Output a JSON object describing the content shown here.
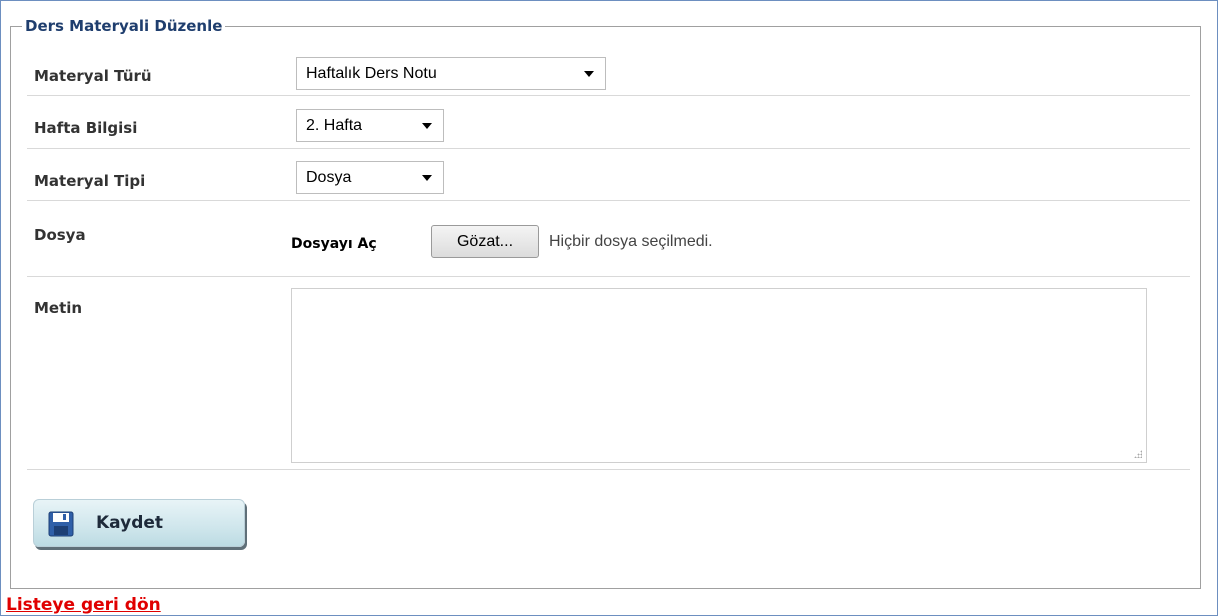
{
  "form": {
    "legend": "Ders Materyali Düzenle",
    "rows": {
      "material_type": {
        "label": "Materyal Türü",
        "value": "Haftalık Ders Notu"
      },
      "week": {
        "label": "Hafta Bilgisi",
        "value": "2. Hafta"
      },
      "material_kind": {
        "label": "Materyal Tipi",
        "value": "Dosya"
      },
      "file": {
        "label": "Dosya",
        "open_label": "Dosyayı Aç",
        "browse_button": "Gözat...",
        "no_file_text": "Hiçbir dosya seçilmedi."
      },
      "text": {
        "label": "Metin",
        "value": ""
      }
    },
    "save_button": "Kaydet"
  },
  "back_link": "Listeye geri dön",
  "colors": {
    "legend_text": "#1f3e6e",
    "link": "#e00000",
    "button_bg": "#cfe6ec"
  }
}
